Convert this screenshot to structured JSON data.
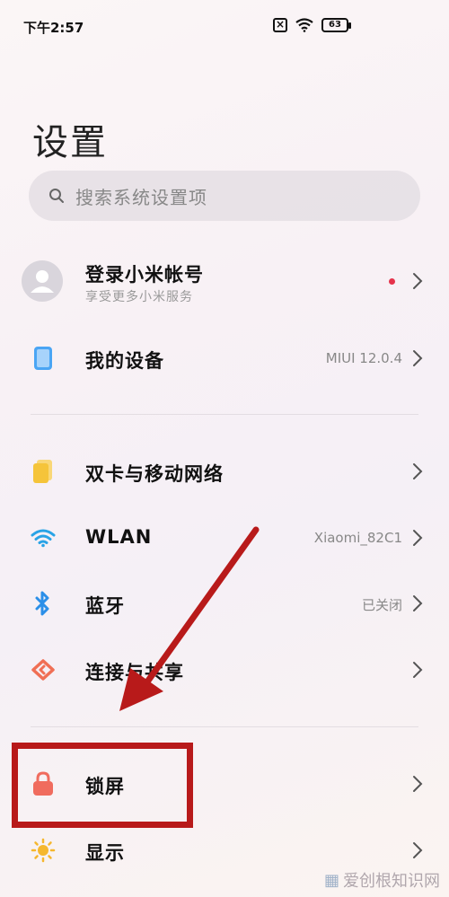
{
  "status_bar": {
    "time": "下午2:57",
    "sim_icon": "sim-x-icon",
    "wifi_icon": "wifi-icon",
    "battery": "63"
  },
  "page": {
    "title": "设置"
  },
  "search": {
    "placeholder": "搜索系统设置项",
    "icon": "search-icon"
  },
  "account": {
    "title": "登录小米帐号",
    "subtitle": "享受更多小米服务",
    "has_notification": true,
    "notification_color": "#e5334b"
  },
  "rows": [
    {
      "label": "我的设备",
      "value": "MIUI 12.0.4",
      "icon": "device-icon",
      "color": "#4aa5f4"
    },
    {
      "label": "双卡与移动网络",
      "value": "",
      "icon": "sim-card-icon",
      "color": "#f5c43a"
    },
    {
      "label": "WLAN",
      "value": "Xiaomi_82C1",
      "icon": "wifi-icon",
      "color": "#29a3e6"
    },
    {
      "label": "蓝牙",
      "value": "已关闭",
      "icon": "bluetooth-icon",
      "color": "#2b8fe8"
    },
    {
      "label": "连接与共享",
      "value": "",
      "icon": "share-icon",
      "color": "#f06f55"
    },
    {
      "label": "锁屏",
      "value": "",
      "icon": "lock-icon",
      "color": "#f06c5e"
    },
    {
      "label": "显示",
      "value": "",
      "icon": "sun-icon",
      "color": "#f5b72e"
    }
  ],
  "annotation": {
    "arrow_color": "#b81a1a"
  },
  "watermark": {
    "text": "爱创根知识网"
  }
}
